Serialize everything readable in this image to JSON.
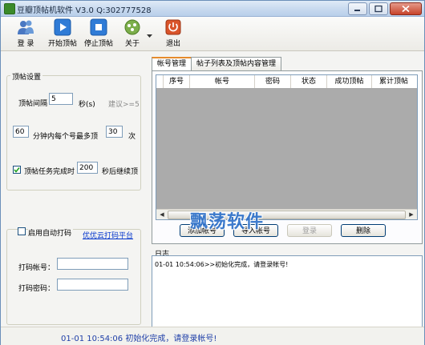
{
  "window": {
    "title": "豆瓣顶帖机软件 V3.0 Q:302777528"
  },
  "toolbar": {
    "login": "登 录",
    "start": "开始顶帖",
    "stop": "停止顶帖",
    "about": "关于",
    "exit": "退出"
  },
  "settings": {
    "group_title": "顶帖设置",
    "interval_label": "顶帖间隔",
    "interval_value": "5",
    "interval_unit": "秒(s)",
    "interval_hint": "建议>=5",
    "minutes_value": "60",
    "per_account_label": "分钟内每个号最多顶",
    "max_count_value": "30",
    "count_unit": "次",
    "resume_label": "顶帖任务完成时",
    "resume_checked": true,
    "resume_seconds": "200",
    "resume_suffix": "秒后继续顶"
  },
  "captcha": {
    "enable_label": "启用自动打码",
    "enable_checked": false,
    "platform_link": "优优云打码平台",
    "account_label": "打码帐号：",
    "account_value": "",
    "password_label": "打码密码：",
    "password_value": ""
  },
  "tabs": [
    {
      "label": "帐号管理",
      "active": true
    },
    {
      "label": "帖子列表及顶帖内容管理",
      "active": false
    }
  ],
  "account_table": {
    "columns": [
      "序号",
      "帐号",
      "密码",
      "状态",
      "成功顶帖",
      "累计顶帖"
    ],
    "rows": []
  },
  "actions": {
    "add": "添加帐号",
    "import": "导入帐号",
    "login": "登录",
    "delete": "删除"
  },
  "log": {
    "label": "日志",
    "lines": [
      "01-01 10:54:06>>初始化完成，请登录帐号!"
    ]
  },
  "status": {
    "text": "01-01 10:54:06 初始化完成，请登录帐号!"
  },
  "watermark": {
    "text": "飘荡软件"
  },
  "colors": {
    "accent_blue": "#2b6fc9",
    "status_blue": "#1f3fa8",
    "grid_bg": "#ababab"
  }
}
